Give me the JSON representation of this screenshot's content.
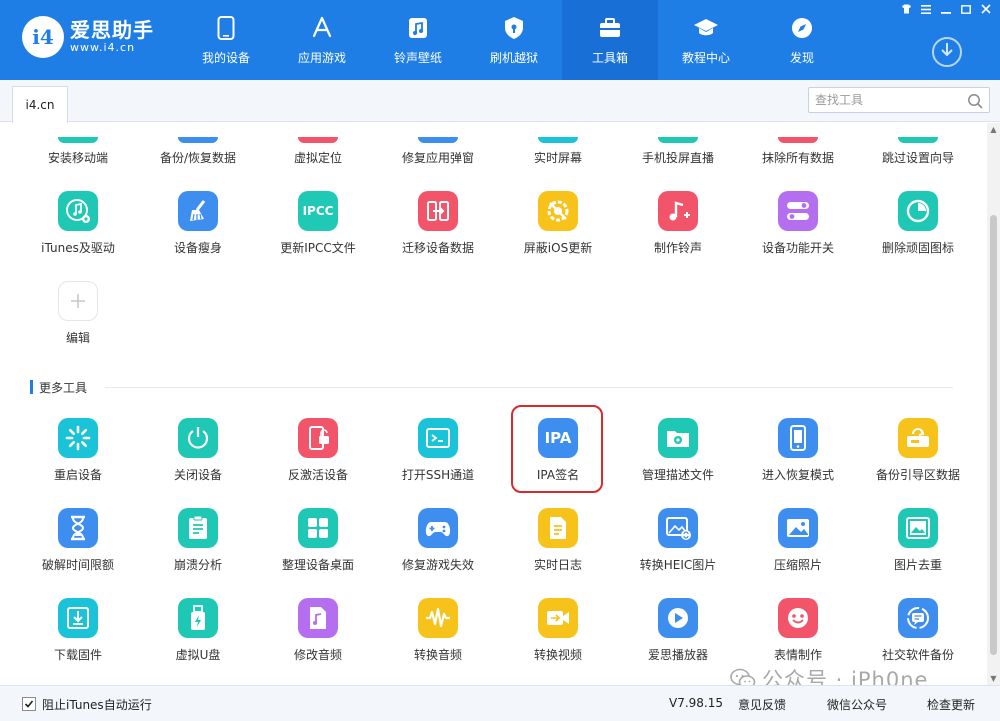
{
  "brand": {
    "name": "爱思助手",
    "url": "www.i4.cn",
    "badge": "i4"
  },
  "nav": [
    {
      "label": "我的设备",
      "icon": "phone-icon"
    },
    {
      "label": "应用游戏",
      "icon": "app-store-icon"
    },
    {
      "label": "铃声壁纸",
      "icon": "music-file-icon"
    },
    {
      "label": "刷机越狱",
      "icon": "shield-lock-icon"
    },
    {
      "label": "工具箱",
      "icon": "toolbox-icon",
      "active": true
    },
    {
      "label": "教程中心",
      "icon": "graduation-cap-icon"
    },
    {
      "label": "发现",
      "icon": "compass-icon"
    }
  ],
  "tab": {
    "label": "i4.cn"
  },
  "search": {
    "placeholder": "查找工具"
  },
  "top_row": [
    "安装移动端",
    "备份/恢复数据",
    "虚拟定位",
    "修复应用弹窗",
    "实时屏幕",
    "手机投屏直播",
    "抹除所有数据",
    "跳过设置向导"
  ],
  "row2": [
    {
      "label": "iTunes及驱动",
      "icon": "itunes-driver-icon",
      "color": "#1ec8b4"
    },
    {
      "label": "设备瘦身",
      "icon": "broom-icon",
      "color": "#3e8ef0"
    },
    {
      "label": "更新IPCC文件",
      "icon": "ipcc-icon",
      "color": "#20c9b6",
      "text": "IPCC"
    },
    {
      "label": "迁移设备数据",
      "icon": "transfer-icon",
      "color": "#f2546a"
    },
    {
      "label": "屏蔽iOS更新",
      "icon": "block-update-icon",
      "color": "#f7c21a"
    },
    {
      "label": "制作铃声",
      "icon": "ringtone-icon",
      "color": "#f2546a"
    },
    {
      "label": "设备功能开关",
      "icon": "toggle-icon",
      "color": "#b56ef0"
    },
    {
      "label": "删除顽固图标",
      "icon": "pie-icon",
      "color": "#1ec8b4"
    }
  ],
  "edit": {
    "label": "编辑"
  },
  "section": {
    "title": "更多工具"
  },
  "more_row1": [
    {
      "label": "重启设备",
      "icon": "restart-icon",
      "color": "#1bc3d8"
    },
    {
      "label": "关闭设备",
      "icon": "power-icon",
      "color": "#1ec8b4"
    },
    {
      "label": "反激活设备",
      "icon": "deactivate-icon",
      "color": "#f2546a"
    },
    {
      "label": "打开SSH通道",
      "icon": "terminal-icon",
      "color": "#1bc3d8"
    },
    {
      "label": "IPA签名",
      "icon": "ipa-icon",
      "color": "#3e8ef0",
      "text": "IPA"
    },
    {
      "label": "管理描述文件",
      "icon": "profile-gear-icon",
      "color": "#1ec8b4"
    },
    {
      "label": "进入恢复模式",
      "icon": "recovery-phone-icon",
      "color": "#3e8ef0"
    },
    {
      "label": "备份引导区数据",
      "icon": "backup-boot-icon",
      "color": "#f7c21a"
    }
  ],
  "more_row2": [
    {
      "label": "破解时间限额",
      "icon": "hourglass-icon",
      "color": "#3e8ef0"
    },
    {
      "label": "崩溃分析",
      "icon": "crash-report-icon",
      "color": "#1ec8b4"
    },
    {
      "label": "整理设备桌面",
      "icon": "grid-icon",
      "color": "#1ec8b4"
    },
    {
      "label": "修复游戏失效",
      "icon": "gamepad-icon",
      "color": "#3e8ef0"
    },
    {
      "label": "实时日志",
      "icon": "log-icon",
      "color": "#f7c21a"
    },
    {
      "label": "转换HEIC图片",
      "icon": "heic-convert-icon",
      "color": "#3e8ef0"
    },
    {
      "label": "压缩照片",
      "icon": "compress-photo-icon",
      "color": "#3e8ef0"
    },
    {
      "label": "图片去重",
      "icon": "dedupe-image-icon",
      "color": "#1ec8b4"
    }
  ],
  "more_row3": [
    {
      "label": "下载固件",
      "icon": "download-firmware-icon",
      "color": "#1bc3d8"
    },
    {
      "label": "虚拟U盘",
      "icon": "usb-drive-icon",
      "color": "#1ec8b4"
    },
    {
      "label": "修改音频",
      "icon": "audio-edit-icon",
      "color": "#b56ef0"
    },
    {
      "label": "转换音频",
      "icon": "audio-wave-icon",
      "color": "#f7c21a"
    },
    {
      "label": "转换视频",
      "icon": "video-convert-icon",
      "color": "#f7c21a"
    },
    {
      "label": "爱思播放器",
      "icon": "play-icon",
      "color": "#3e8ef0"
    },
    {
      "label": "表情制作",
      "icon": "emoji-icon",
      "color": "#f2546a"
    },
    {
      "label": "社交软件备份",
      "icon": "chat-backup-icon",
      "color": "#3e8ef0"
    }
  ],
  "footer": {
    "checkbox_label": "阻止iTunes自动运行",
    "version": "V7.98.15",
    "feedback": "意见反馈",
    "wechat": "微信公众号",
    "update": "检查更新"
  },
  "watermark": {
    "text": "公众号 · iPh0ne"
  }
}
